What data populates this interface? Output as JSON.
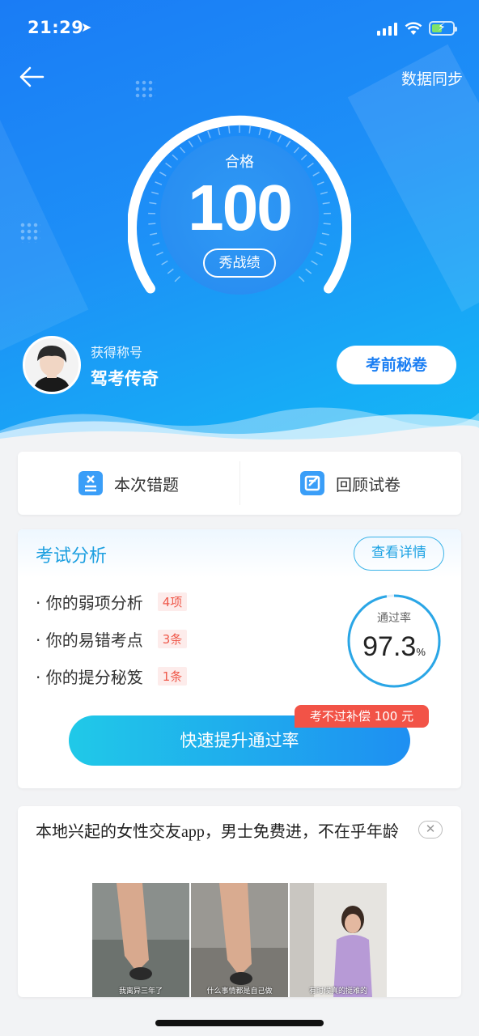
{
  "status": {
    "time": "21:29",
    "location_glyph": "➤"
  },
  "header": {
    "back_icon": "arrow-left-icon",
    "sync_label": "数据同步"
  },
  "score": {
    "pass_label": "合格",
    "value": "100",
    "show_button": "秀战绩"
  },
  "profile": {
    "caption": "获得称号",
    "title": "驾考传奇",
    "secret_button": "考前秘卷"
  },
  "quick_actions": [
    {
      "label": "本次错题",
      "icon": "wrong-questions-icon"
    },
    {
      "label": "回顾试卷",
      "icon": "review-paper-icon"
    }
  ],
  "analysis": {
    "title": "考试分析",
    "detail_button": "查看详情",
    "items": [
      {
        "label": "· 你的弱项分析",
        "tag": "4项"
      },
      {
        "label": "· 你的易错考点",
        "tag": "3条"
      },
      {
        "label": "· 你的提分秘笈",
        "tag": "1条"
      }
    ],
    "pass_rate_caption": "通过率",
    "pass_rate_value": "97.3",
    "pass_rate_unit": "%",
    "pass_rate_fraction": 0.973,
    "compensation_tag": "考不过补偿 100 元",
    "boost_button": "快速提升通过率"
  },
  "ad": {
    "text": "本地兴起的女性交友app，男士免费进，不在乎年龄",
    "close_icon": "close-icon",
    "captions": [
      "我离异三年了",
      "什么事情都是自己做",
      "有时候真的挺难的"
    ]
  },
  "colors": {
    "primary": "#1c7ff3",
    "accent_cyan": "#1ca2e3",
    "danger": "#f25347"
  }
}
